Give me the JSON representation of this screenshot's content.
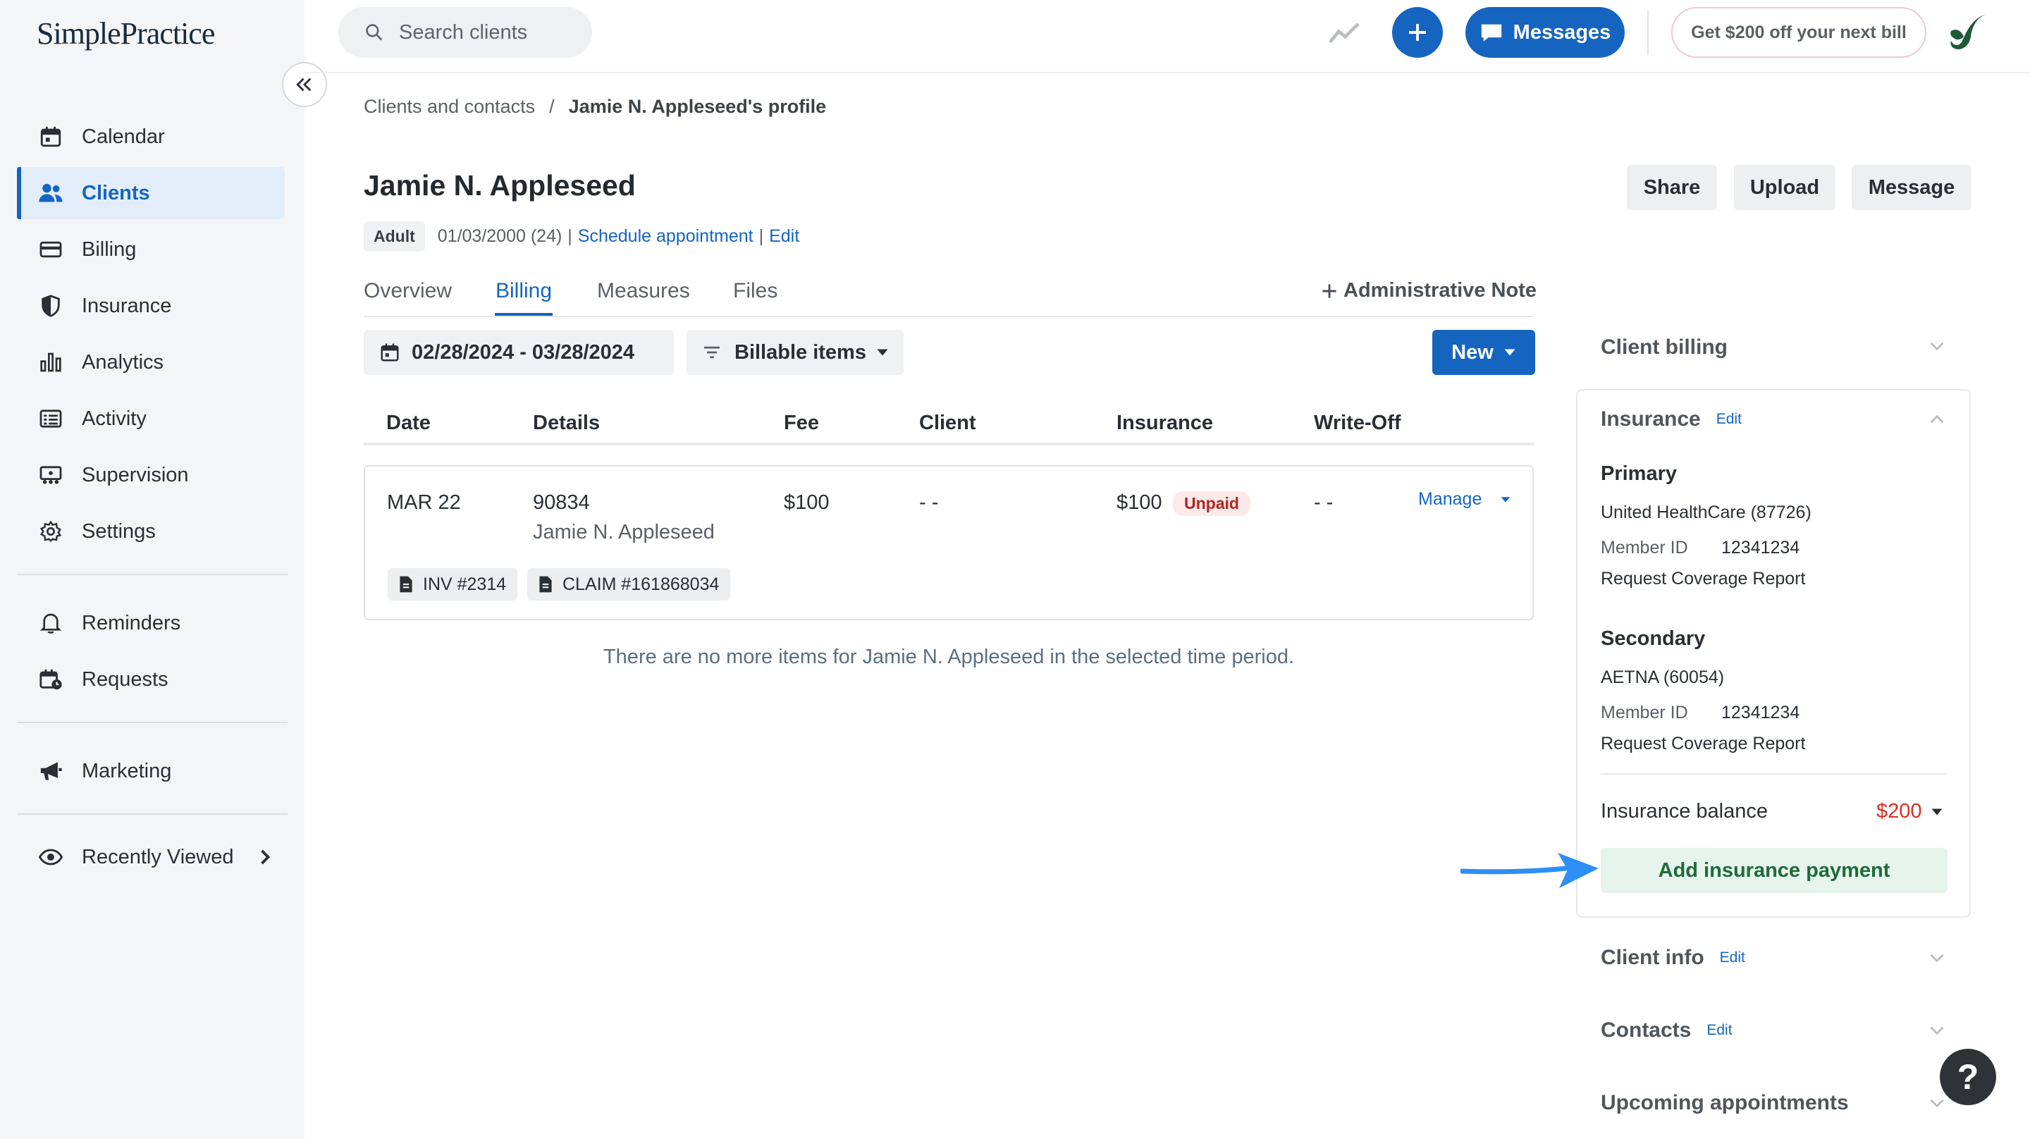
{
  "app": {
    "logo": "SimplePractice"
  },
  "sidebar": {
    "items": [
      {
        "label": "Calendar",
        "icon": "calendar-icon"
      },
      {
        "label": "Clients",
        "icon": "users-icon",
        "active": true
      },
      {
        "label": "Billing",
        "icon": "credit-card-icon"
      },
      {
        "label": "Insurance",
        "icon": "shield-icon"
      },
      {
        "label": "Analytics",
        "icon": "bar-chart-icon"
      },
      {
        "label": "Activity",
        "icon": "list-icon"
      },
      {
        "label": "Supervision",
        "icon": "supervision-icon"
      },
      {
        "label": "Settings",
        "icon": "gear-icon"
      },
      {
        "label": "Reminders",
        "icon": "bell-icon"
      },
      {
        "label": "Requests",
        "icon": "calendar-request-icon"
      },
      {
        "label": "Marketing",
        "icon": "megaphone-icon"
      },
      {
        "label": "Recently Viewed",
        "icon": "eye-icon"
      }
    ]
  },
  "topbar": {
    "search_placeholder": "Search clients",
    "messages_label": "Messages",
    "promo_label": "Get $200 off your next bill"
  },
  "breadcrumb": {
    "parent": "Clients and contacts",
    "sep": "/",
    "current": "Jamie N. Appleseed's profile"
  },
  "client": {
    "name": "Jamie N. Appleseed",
    "tag": "Adult",
    "dob": "01/03/2000 (24)",
    "schedule_link": "Schedule appointment",
    "edit_link": "Edit",
    "pipe": "|"
  },
  "header_buttons": {
    "share": "Share",
    "upload": "Upload",
    "message": "Message"
  },
  "tabs": [
    {
      "label": "Overview"
    },
    {
      "label": "Billing",
      "active": true
    },
    {
      "label": "Measures"
    },
    {
      "label": "Files"
    }
  ],
  "admin_note": "Administrative Note",
  "filters": {
    "date_range": "02/28/2024 - 03/28/2024",
    "items": "Billable items",
    "new": "New"
  },
  "table": {
    "headers": [
      "Date",
      "Details",
      "Fee",
      "Client",
      "Insurance",
      "Write-Off"
    ],
    "row": {
      "date": "MAR 22",
      "code": "90834",
      "client_name": "Jamie N. Appleseed",
      "fee": "$100",
      "client": "- -",
      "insurance": "$100",
      "status": "Unpaid",
      "writeoff": "- -",
      "manage": "Manage",
      "invoice": "INV #2314",
      "claim": "CLAIM #161868034"
    },
    "empty_message": "There are no more items for Jamie N. Appleseed in the selected time period."
  },
  "right_panel": {
    "client_billing": "Client billing",
    "insurance": "Insurance",
    "edit": "Edit",
    "primary": {
      "title": "Primary",
      "payer": "United HealthCare (87726)",
      "member_label": "Member ID",
      "member_id": "12341234",
      "link": "Request Coverage Report"
    },
    "secondary": {
      "title": "Secondary",
      "payer": "AETNA (60054)",
      "member_label": "Member ID",
      "member_id": "12341234",
      "link": "Request Coverage Report"
    },
    "balance_label": "Insurance balance",
    "balance_value": "$200",
    "add_payment": "Add insurance payment",
    "client_info": "Client info",
    "contacts": "Contacts",
    "upcoming": "Upcoming appointments"
  },
  "help": "?",
  "colors": {
    "brand_blue": "#1565c0",
    "unpaid_red": "#b3261e",
    "balance_red": "#d93025",
    "add_payment_green": "#1f6b3a",
    "arrow_blue": "#2f8ef4"
  }
}
